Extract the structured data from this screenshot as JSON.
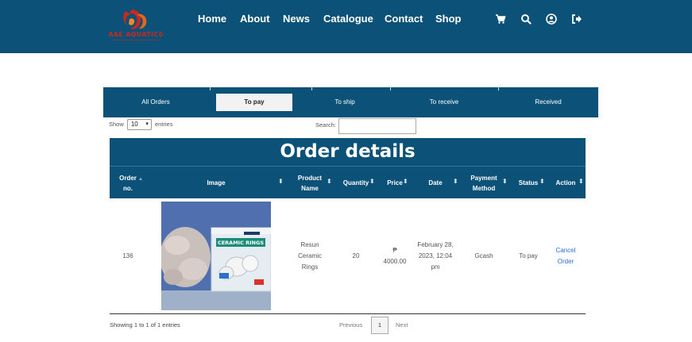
{
  "header": {
    "logo_text": "AAE AQUATICS",
    "nav": [
      "Home",
      "About",
      "News",
      "Catalogue",
      "Contact",
      "Shop"
    ],
    "icons": [
      "cart-icon",
      "search-icon",
      "user-icon",
      "logout-icon"
    ]
  },
  "tabs": [
    "All Orders",
    "To pay",
    "To ship",
    "To receive",
    "Received"
  ],
  "active_tab": "To pay",
  "controls": {
    "show_label": "Show",
    "entries_value": "10",
    "entries_label": "entries",
    "search_label": "Search:",
    "search_value": ""
  },
  "table": {
    "title": "Order details",
    "columns": [
      "Order no.",
      "Image",
      "Product Name",
      "Quantity",
      "Price",
      "Date",
      "Payment Method",
      "Status",
      "Action"
    ],
    "rows": [
      {
        "order_no": "136",
        "product_name": "Resun Ceramic Rings",
        "image_label": "CERAMIC RINGS",
        "quantity": "20",
        "price_symbol": "₱",
        "price": "4000.00",
        "date": "February 28, 2023, 12:04 pm",
        "payment_method": "Gcash",
        "status": "To pay",
        "action": "Cancel Order"
      }
    ]
  },
  "footer": {
    "info": "Showing 1 to 1 of 1 entries",
    "previous": "Previous",
    "page": "1",
    "next": "Next"
  },
  "colors": {
    "primary": "#0c5177",
    "link": "#2a6fd6"
  }
}
